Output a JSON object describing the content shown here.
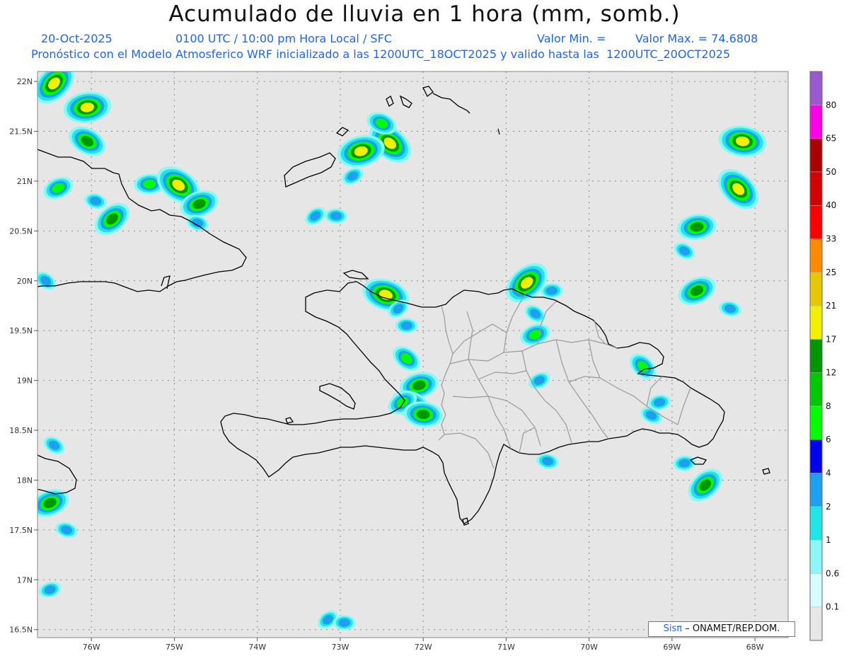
{
  "header": {
    "title": "Acumulado de lluvia en 1 hora (mm, somb.)",
    "date": "20-Oct-2025",
    "time_info": "0100 UTC / 10:00 pm Hora Local / SFC",
    "valor_min": "Valor Min. =",
    "valor_max": "Valor Max. = 74.6808",
    "model_info": "Pronóstico con el Modelo Atmosferico WRF inicializado a las 1200UTC_18OCT2025 y valido hasta las  1200UTC_20OCT2025"
  },
  "axes": {
    "lat_labels": [
      "22N",
      "21.5N",
      "21N",
      "20.5N",
      "20N",
      "19.5N",
      "19N",
      "18.5N",
      "18N",
      "17.5N",
      "17N",
      "16.5N"
    ],
    "lon_labels": [
      "76W",
      "75W",
      "74W",
      "73W",
      "72W",
      "71W",
      "70W",
      "69W",
      "68W"
    ],
    "lat_range": [
      16.5,
      22.0
    ],
    "lon_range": [
      -76.65,
      -67.6
    ]
  },
  "colorbar": {
    "labels": [
      "0.1",
      "0.6",
      "1",
      "2",
      "4",
      "6",
      "8",
      "12",
      "17",
      "21",
      "25",
      "33",
      "40",
      "50",
      "65",
      "80"
    ],
    "colors": [
      "#e6e6e6",
      "#d6fcff",
      "#8cf7f7",
      "#1ee6e6",
      "#1ea0f0",
      "#0000f0",
      "#00ff00",
      "#00c800",
      "#009600",
      "#f0f000",
      "#e6c800",
      "#ff8c00",
      "#ff0000",
      "#d20000",
      "#aa0000",
      "#ff00e6",
      "#9b59d0"
    ]
  },
  "credit": {
    "brand": "Sisπ",
    "text": "– ONAMET/REP.DOM."
  },
  "rain_cells": [
    {
      "lon": -76.45,
      "lat": 21.98,
      "level": 4
    },
    {
      "lon": -76.05,
      "lat": 21.74,
      "level": 4
    },
    {
      "lon": -76.05,
      "lat": 21.4,
      "level": 3
    },
    {
      "lon": -76.4,
      "lat": 20.93,
      "level": 2
    },
    {
      "lon": -75.95,
      "lat": 20.8,
      "level": 1
    },
    {
      "lon": -75.75,
      "lat": 20.62,
      "level": 3
    },
    {
      "lon": -75.3,
      "lat": 20.97,
      "level": 2
    },
    {
      "lon": -74.95,
      "lat": 20.96,
      "level": 4
    },
    {
      "lon": -74.7,
      "lat": 20.77,
      "level": 3
    },
    {
      "lon": -74.72,
      "lat": 20.58,
      "level": 1
    },
    {
      "lon": -73.3,
      "lat": 20.65,
      "level": 1
    },
    {
      "lon": -73.05,
      "lat": 20.65,
      "level": 1
    },
    {
      "lon": -72.4,
      "lat": 21.38,
      "level": 4
    },
    {
      "lon": -72.75,
      "lat": 21.3,
      "level": 4
    },
    {
      "lon": -72.5,
      "lat": 21.58,
      "level": 2
    },
    {
      "lon": -72.85,
      "lat": 21.05,
      "level": 1
    },
    {
      "lon": -68.15,
      "lat": 21.4,
      "level": 4
    },
    {
      "lon": -68.2,
      "lat": 20.92,
      "level": 4
    },
    {
      "lon": -68.7,
      "lat": 20.54,
      "level": 3
    },
    {
      "lon": -68.85,
      "lat": 20.3,
      "level": 1
    },
    {
      "lon": -68.7,
      "lat": 19.9,
      "level": 3
    },
    {
      "lon": -68.3,
      "lat": 19.72,
      "level": 1
    },
    {
      "lon": -70.75,
      "lat": 19.98,
      "level": 4
    },
    {
      "lon": -70.45,
      "lat": 19.9,
      "level": 1
    },
    {
      "lon": -70.65,
      "lat": 19.67,
      "level": 1
    },
    {
      "lon": -70.65,
      "lat": 19.46,
      "level": 2
    },
    {
      "lon": -72.45,
      "lat": 19.86,
      "level": 4
    },
    {
      "lon": -72.3,
      "lat": 19.72,
      "level": 1
    },
    {
      "lon": -72.2,
      "lat": 19.55,
      "level": 1
    },
    {
      "lon": -72.2,
      "lat": 19.22,
      "level": 2
    },
    {
      "lon": -72.05,
      "lat": 18.95,
      "level": 3
    },
    {
      "lon": -72.15,
      "lat": 18.76,
      "level": 3
    },
    {
      "lon": -72.25,
      "lat": 18.78,
      "level": 2
    },
    {
      "lon": -72.0,
      "lat": 18.66,
      "level": 3
    },
    {
      "lon": -69.35,
      "lat": 19.14,
      "level": 2
    },
    {
      "lon": -69.15,
      "lat": 18.78,
      "level": 1
    },
    {
      "lon": -69.25,
      "lat": 18.65,
      "level": 1
    },
    {
      "lon": -70.6,
      "lat": 19.0,
      "level": 1
    },
    {
      "lon": -70.5,
      "lat": 18.19,
      "level": 1
    },
    {
      "lon": -68.6,
      "lat": 17.95,
      "level": 3
    },
    {
      "lon": -68.85,
      "lat": 18.17,
      "level": 1
    },
    {
      "lon": -76.45,
      "lat": 18.35,
      "level": 1
    },
    {
      "lon": -76.5,
      "lat": 17.77,
      "level": 3
    },
    {
      "lon": -76.3,
      "lat": 17.5,
      "level": 1
    },
    {
      "lon": -73.15,
      "lat": 16.6,
      "level": 1
    },
    {
      "lon": -72.95,
      "lat": 16.57,
      "level": 1
    },
    {
      "lon": -76.55,
      "lat": 20.0,
      "level": 1
    },
    {
      "lon": -76.5,
      "lat": 16.9,
      "level": 1
    }
  ]
}
